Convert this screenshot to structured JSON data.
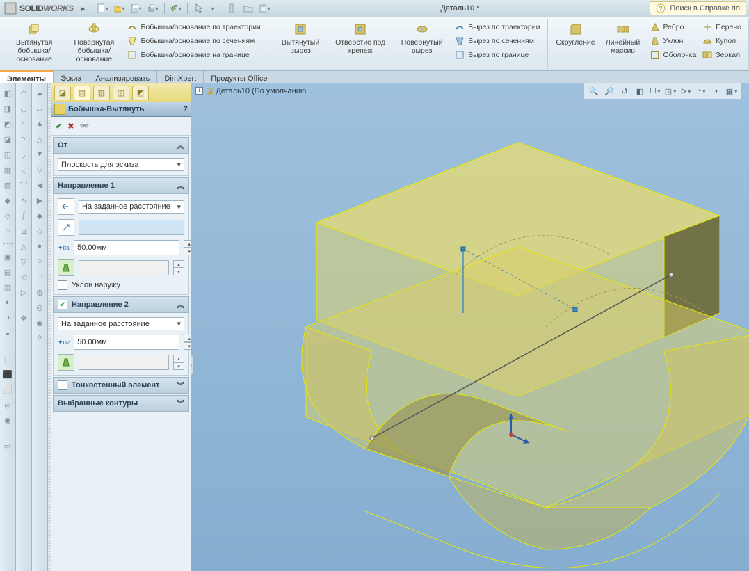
{
  "app": {
    "name_plain": "SOLID",
    "name_bold": "WORKS"
  },
  "doc": {
    "title": "Деталь10 *"
  },
  "search": {
    "placeholder": "Поиск в Справке по"
  },
  "ribbon": {
    "big": {
      "extrude": "Вытянутая бобышка/основание",
      "revolve": "Повернутая бобышка/основание",
      "cut": "Вытянутый вырез",
      "hole": "Отверстие под крепеж",
      "revcut": "Повернутый вырез",
      "fillet": "Скругление",
      "pattern": "Линейный массив"
    },
    "rows": {
      "sweep": "Бобышка/основание по траектории",
      "loft": "Бобышка/основание по сечениям",
      "boundary": "Бобышка/основание на границе",
      "cut_sweep": "Вырез по траектории",
      "cut_loft": "Вырез по сечениям",
      "cut_bound": "Вырез по границе",
      "rib": "Ребро",
      "draft": "Уклон",
      "shell": "Оболочка",
      "move": "Перено",
      "dome": "Купол",
      "mirror": "Зеркал"
    }
  },
  "tabs": {
    "t1": "Элементы",
    "t2": "Эскиз",
    "t3": "Анализировать",
    "t4": "DimXpert",
    "t5": "Продукты Office"
  },
  "pm": {
    "title": "Бобышка-Вытянуть",
    "from_hdr": "От",
    "from_sel": "Плоскость для эскиза",
    "d1_hdr": "Направление 1",
    "d2_hdr": "Направление 2",
    "end_sel": "На заданное расстояние",
    "end_sel2": "На заданное расстояние",
    "dist1": "50.00мм",
    "dist2": "50.00мм",
    "draft_out": "Уклон наружу",
    "thin_hdr": "Тонкостенный элемент",
    "contours_hdr": "Выбранные контуры"
  },
  "tree": {
    "root": "Деталь10  (По умолчанию..."
  }
}
